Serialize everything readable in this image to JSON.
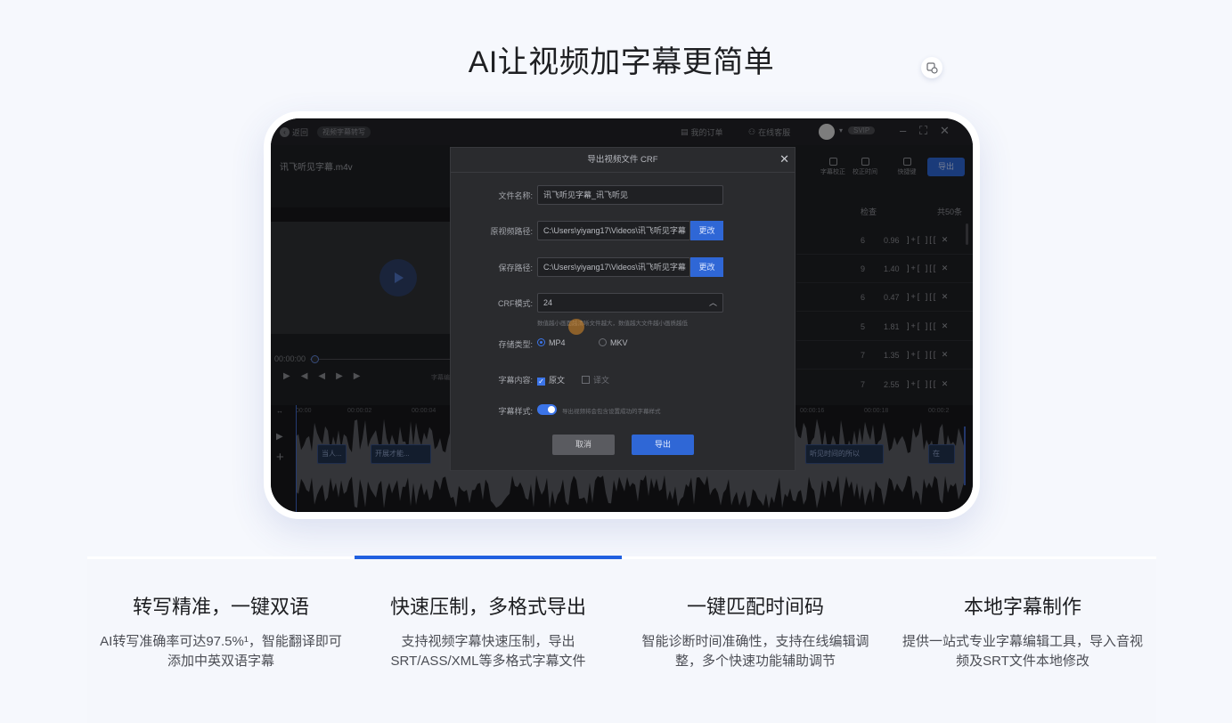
{
  "page": {
    "title": "AI让视频加字幕更简单"
  },
  "app": {
    "back_label": "返回",
    "top_pill": "视频字幕转写",
    "my_orders": "我的订单",
    "online_service": "在线客服",
    "svip": "SVIP",
    "file_name": "讯飞听见字幕.m4v",
    "tools": [
      "字幕校正",
      "校正时间",
      "快捷键"
    ],
    "export_label": "导出",
    "timecode": "00:00:00",
    "subtitle_hint": "字幕编",
    "list": {
      "check_label": "检查",
      "total_label": "共50条",
      "rows": [
        {
          "num": "6",
          "dur": "0.96"
        },
        {
          "num": "9",
          "dur": "1.40"
        },
        {
          "num": "6",
          "dur": "0.47"
        },
        {
          "num": "5",
          "dur": "1.81"
        },
        {
          "num": "7",
          "dur": "1.35"
        },
        {
          "num": "7",
          "dur": "2.55"
        }
      ]
    },
    "timeline": {
      "ruler": [
        "00:00",
        "00:00:02",
        "00:00:04",
        "00:00:16",
        "00:00:18",
        "00:00:2"
      ],
      "clips": [
        "当人...",
        "开展才能...",
        "听见时间的所以",
        "在"
      ]
    }
  },
  "dialog": {
    "title": "导出视频文件 CRF",
    "file_name_label": "文件名称:",
    "file_name_value": "讯飞听见字幕_讯飞听见",
    "source_path_label": "原视频路径:",
    "source_path_value": "C:\\Users\\yiyang17\\Videos\\讯飞听见字幕",
    "save_path_label": "保存路径:",
    "save_path_value": "C:\\Users\\yiyang17\\Videos\\讯飞听见字幕",
    "change_label": "更改",
    "crf_label": "CRF模式:",
    "crf_value": "24",
    "crf_hint": "数值越小画面越清晰文件越大，数值越大文件越小画质越低",
    "storage_label": "存储类型:",
    "storage_options": [
      "MP4",
      "MKV"
    ],
    "storage_selected": "MP4",
    "content_label": "字幕内容:",
    "content_options": [
      "原文",
      "译文"
    ],
    "style_label": "字幕样式:",
    "style_hint": "导出视频将会包含设置成功的字幕样式",
    "cancel_label": "取消",
    "ok_label": "导出"
  },
  "features": [
    {
      "title": "转写精准，一键双语",
      "desc": "AI转写准确率可达97.5%¹，智能翻译即可添加中英双语字幕"
    },
    {
      "title": "快速压制，多格式导出",
      "desc": "支持视频字幕快速压制，导出SRT/ASS/XML等多格式字幕文件"
    },
    {
      "title": "一键匹配时间码",
      "desc": "智能诊断时间准确性，支持在线编辑调整，多个快速功能辅助调节"
    },
    {
      "title": "本地字幕制作",
      "desc": "提供一站式专业字幕编辑工具，导入音视频及SRT文件本地修改"
    }
  ],
  "active_tab": 1,
  "colors": {
    "accent": "#2060e0",
    "page_bg": "#f6f8fd",
    "app_bg": "#1e1f23",
    "dialog_bg": "#2a2b2e"
  }
}
